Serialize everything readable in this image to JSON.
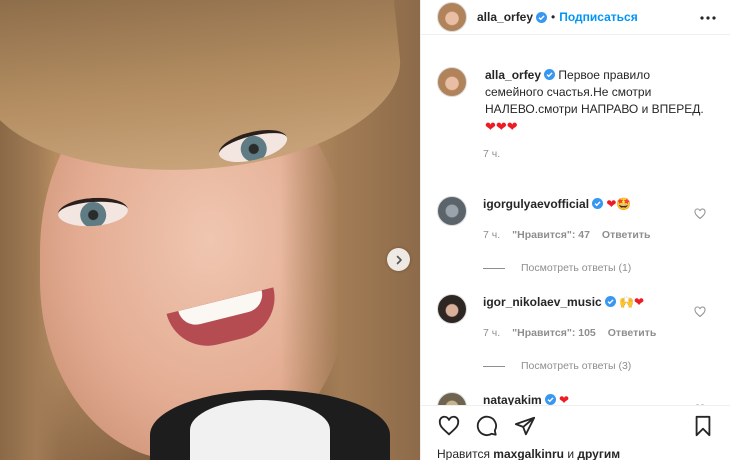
{
  "header": {
    "username": "alla_orfey",
    "separator": "•",
    "follow_label": "Подписаться",
    "avatar_icon": "profile-avatar",
    "more_icon": "more-horizontal-icon"
  },
  "post": {
    "next_icon": "chevron-right-icon"
  },
  "caption": {
    "username": "alla_orfey",
    "text": "Первое правило семейного счастья.Не смотри НАЛЕВО.смотри НАПРАВО и ВПЕРЕД.",
    "hearts": "❤❤❤",
    "time": "7 ч."
  },
  "comments": [
    {
      "username": "igorgulyaevofficial",
      "text_emoji": "❤🤩",
      "time": "7 ч.",
      "likes": "\"Нравится\": 47",
      "reply": "Ответить",
      "replies": "Посмотреть ответы (1)"
    },
    {
      "username": "igor_nikolaev_music",
      "text_emoji": "🙌❤",
      "time": "7 ч.",
      "likes": "\"Нравится\": 105",
      "reply": "Ответить",
      "replies": "Посмотреть ответы (3)"
    },
    {
      "username": "natayakim",
      "text_emoji": "❤"
    }
  ],
  "actions": {
    "like_icon": "heart-icon",
    "comment_icon": "comment-icon",
    "share_icon": "paper-plane-icon",
    "save_icon": "bookmark-icon"
  },
  "likes_line": {
    "prefix": "Нравится",
    "user": "maxgalkinru",
    "suffix": "и",
    "others": "другим"
  },
  "colors": {
    "accent": "#0095f6",
    "heart": "#ed1c24",
    "muted": "#8e8e8e"
  }
}
